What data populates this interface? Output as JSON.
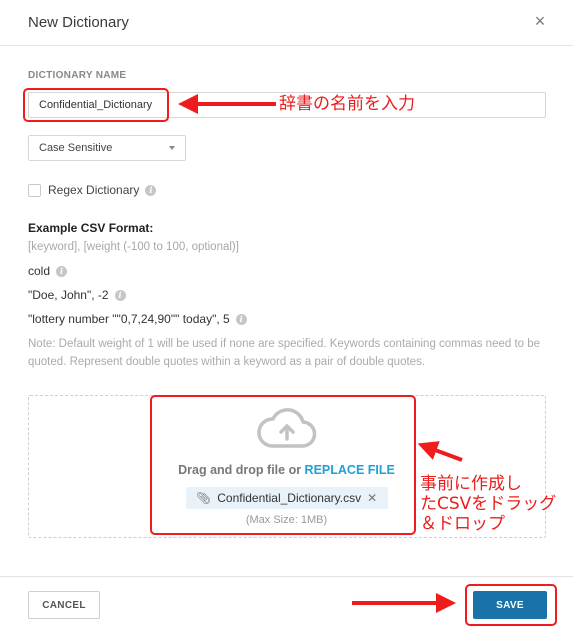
{
  "dialog": {
    "title": "New Dictionary",
    "close_icon": "×"
  },
  "form": {
    "name_label": "DICTIONARY NAME",
    "name_value": "Confidential_Dictionary",
    "case_select_value": "Case Sensitive",
    "regex_label": "Regex Dictionary",
    "regex_checked": false
  },
  "example": {
    "title": "Example CSV Format:",
    "format_hint": "[keyword], [weight (-100 to 100, optional)]",
    "lines": [
      "cold",
      "\"Doe, John\", -2",
      "\"lottery number \"\"0,7,24,90\"\" today\", 5"
    ],
    "note": "Note: Default weight of 1 will be used if none are specified. Keywords containing commas need to be quoted. Represent double quotes within a keyword as a pair of double quotes."
  },
  "upload": {
    "icon": "cloud-upload-icon",
    "drag_text": "Drag and drop file or ",
    "replace_link": "REPLACE FILE",
    "file_name": "Confidential_Dictionary.csv",
    "max_size": "(Max Size: 1MB)"
  },
  "footer": {
    "cancel_label": "CANCEL",
    "save_label": "SAVE"
  },
  "annotations": {
    "name_note": "辞書の名前を入力",
    "upload_note": "事前に作成し\nたCSVをドラッグ\n＆ドロップ"
  },
  "colors": {
    "accent": "#1ea0d8",
    "save_button": "#1a73a8",
    "annotation": "#ee1c1c"
  }
}
